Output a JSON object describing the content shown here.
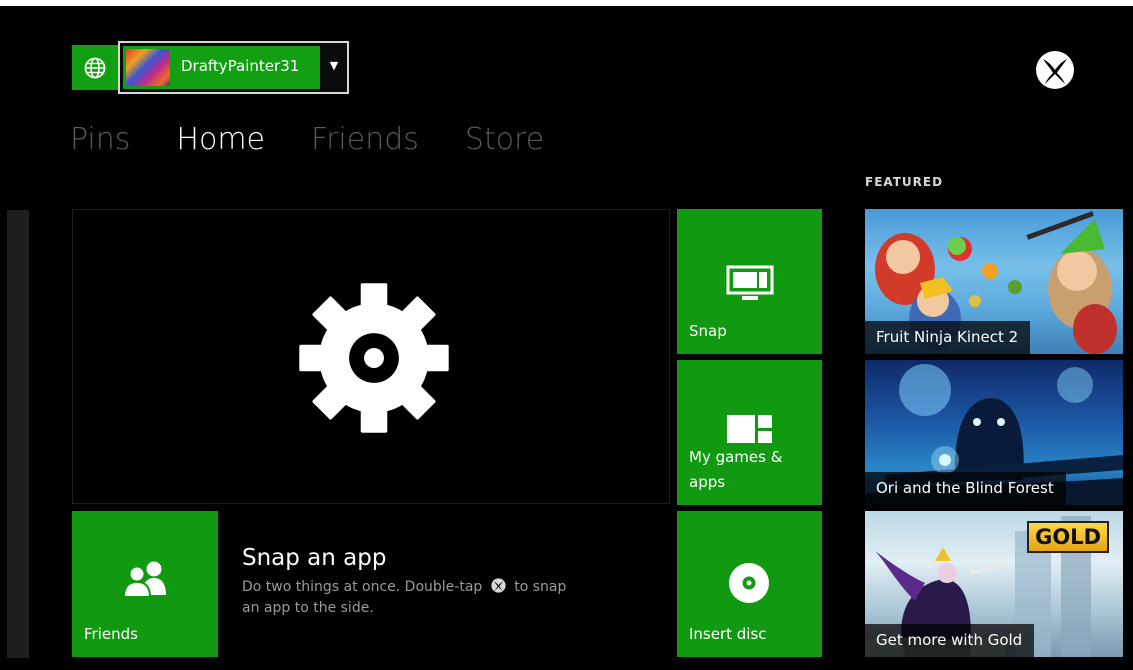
{
  "header": {
    "gamertag": "DraftyPainter31",
    "icons": {
      "globe": "globe-icon",
      "caret": "caret-down-icon",
      "logo": "xbox-logo-icon"
    }
  },
  "tabs": [
    {
      "label": "Pins",
      "active": false
    },
    {
      "label": "Home",
      "active": true
    },
    {
      "label": "Friends",
      "active": false
    },
    {
      "label": "Store",
      "active": false
    }
  ],
  "main": {
    "big_tile_icon": "settings-gear-icon",
    "tiles": {
      "snap": "Snap",
      "my_games_apps": "My games & apps",
      "insert_disc": "Insert disc",
      "friends": "Friends"
    },
    "info": {
      "title": "Snap an app",
      "desc_part1": "Do two things at once. Double-tap",
      "desc_part2": "to snap an app to the side."
    }
  },
  "featured": {
    "heading": "FEATURED",
    "items": [
      {
        "label": "Fruit Ninja Kinect 2"
      },
      {
        "label": "Ori and the Blind Forest"
      },
      {
        "label": "Get more with Gold",
        "badge": "GOLD"
      }
    ]
  },
  "colors": {
    "accent": "#119911",
    "background": "#000000",
    "inactive_tab": "#5a5a5a"
  }
}
